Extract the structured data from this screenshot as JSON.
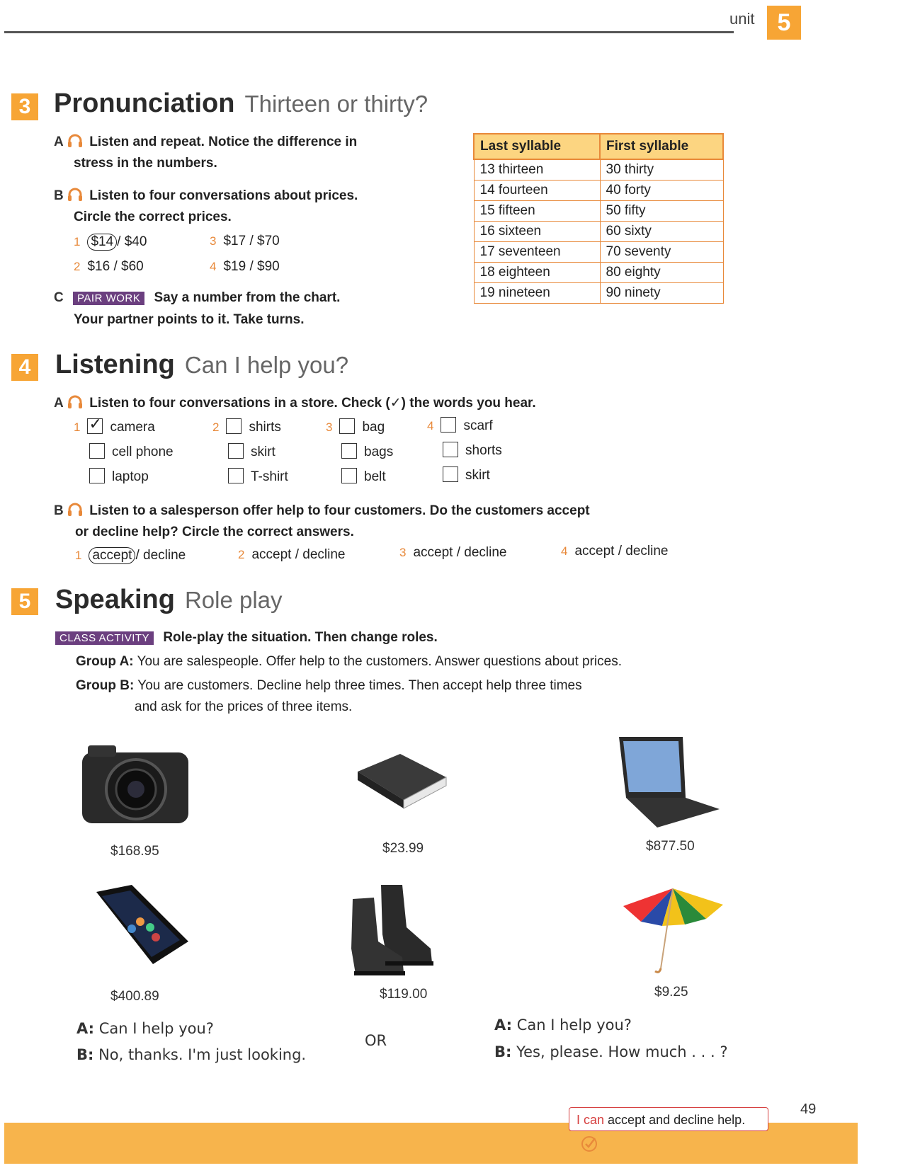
{
  "header": {
    "unit_label": "unit",
    "unit_number": "5"
  },
  "pronunciation": {
    "number": "3",
    "title": "Pronunciation",
    "subtitle": "Thirteen or thirty?",
    "a": {
      "letter": "A",
      "line1": "Listen and repeat. Notice the difference in",
      "line2": "stress in the numbers."
    },
    "b": {
      "letter": "B",
      "line1": "Listen to four conversations about prices.",
      "line2": "Circle the correct prices.",
      "items": [
        {
          "num": "1",
          "first": "$14",
          "rest": "/ $40"
        },
        {
          "num": "2",
          "text": "$16 / $60"
        },
        {
          "num": "3",
          "text": "$17 / $70"
        },
        {
          "num": "4",
          "text": "$19 / $90"
        }
      ]
    },
    "c": {
      "letter": "C",
      "badge": "PAIR WORK",
      "line1": "Say a number from the chart.",
      "line2": "Your partner points to it. Take turns."
    },
    "table": {
      "headers": [
        "Last syllable",
        "First syllable"
      ],
      "rows": [
        [
          "13 thirteen",
          "30 thirty"
        ],
        [
          "14 fourteen",
          "40 forty"
        ],
        [
          "15 fifteen",
          "50 fifty"
        ],
        [
          "16 sixteen",
          "60 sixty"
        ],
        [
          "17 seventeen",
          "70 seventy"
        ],
        [
          "18 eighteen",
          "80 eighty"
        ],
        [
          "19 nineteen",
          "90 ninety"
        ]
      ]
    }
  },
  "listening": {
    "number": "4",
    "title": "Listening",
    "subtitle": "Can I help you?",
    "a": {
      "letter": "A",
      "text": "Listen to four conversations in a store. Check (✓) the words you hear.",
      "groups": [
        {
          "num": "1",
          "words": [
            "camera",
            "cell phone",
            "laptop"
          ],
          "checked": [
            true,
            false,
            false
          ]
        },
        {
          "num": "2",
          "words": [
            "shirts",
            "skirt",
            "T-shirt"
          ],
          "checked": [
            false,
            false,
            false
          ]
        },
        {
          "num": "3",
          "words": [
            "bag",
            "bags",
            "belt"
          ],
          "checked": [
            false,
            false,
            false
          ]
        },
        {
          "num": "4",
          "words": [
            "scarf",
            "shorts",
            "skirt"
          ],
          "checked": [
            false,
            false,
            false
          ]
        }
      ]
    },
    "b": {
      "letter": "B",
      "line1": "Listen to a salesperson offer help to four customers. Do the customers accept",
      "line2": "or decline help? Circle the correct answers.",
      "items": [
        {
          "num": "1",
          "first": "accept",
          "rest": "/ decline"
        },
        {
          "num": "2",
          "text": "accept / decline"
        },
        {
          "num": "3",
          "text": "accept / decline"
        },
        {
          "num": "4",
          "text": "accept / decline"
        }
      ]
    }
  },
  "speaking": {
    "number": "5",
    "title": "Speaking",
    "subtitle": "Role play",
    "badge": "CLASS ACTIVITY",
    "instruction": "Role-play the situation. Then change roles.",
    "group_a_label": "Group A:",
    "group_a_text": "You are salespeople. Offer help to the customers. Answer questions about prices.",
    "group_b_label": "Group B:",
    "group_b_line1": "You are customers. Decline help three times. Then accept help three times",
    "group_b_line2": "and ask for the prices of three items.",
    "items": [
      {
        "name": "camera",
        "price": "$168.95"
      },
      {
        "name": "book",
        "price": "$23.99"
      },
      {
        "name": "laptop",
        "price": "$877.50"
      },
      {
        "name": "cell phone",
        "price": "$400.89"
      },
      {
        "name": "shoes",
        "price": "$119.00"
      },
      {
        "name": "umbrella",
        "price": "$9.25"
      }
    ],
    "dialog1": {
      "a_label": "A:",
      "a_text": "Can I help you?",
      "b_label": "B:",
      "b_text": "No, thanks. I'm just looking."
    },
    "or": "OR",
    "dialog2": {
      "a_label": "A:",
      "a_text": "Can I help you?",
      "b_label": "B:",
      "b_text": "Yes, please. How much . . . ?"
    }
  },
  "footer": {
    "can_word": "I can",
    "can_text": "accept and decline help.",
    "page_number": "49"
  },
  "colors": {
    "accent_orange": "#f7a535",
    "badge_purple": "#6b3f7f",
    "table_header": "#fcd581"
  }
}
